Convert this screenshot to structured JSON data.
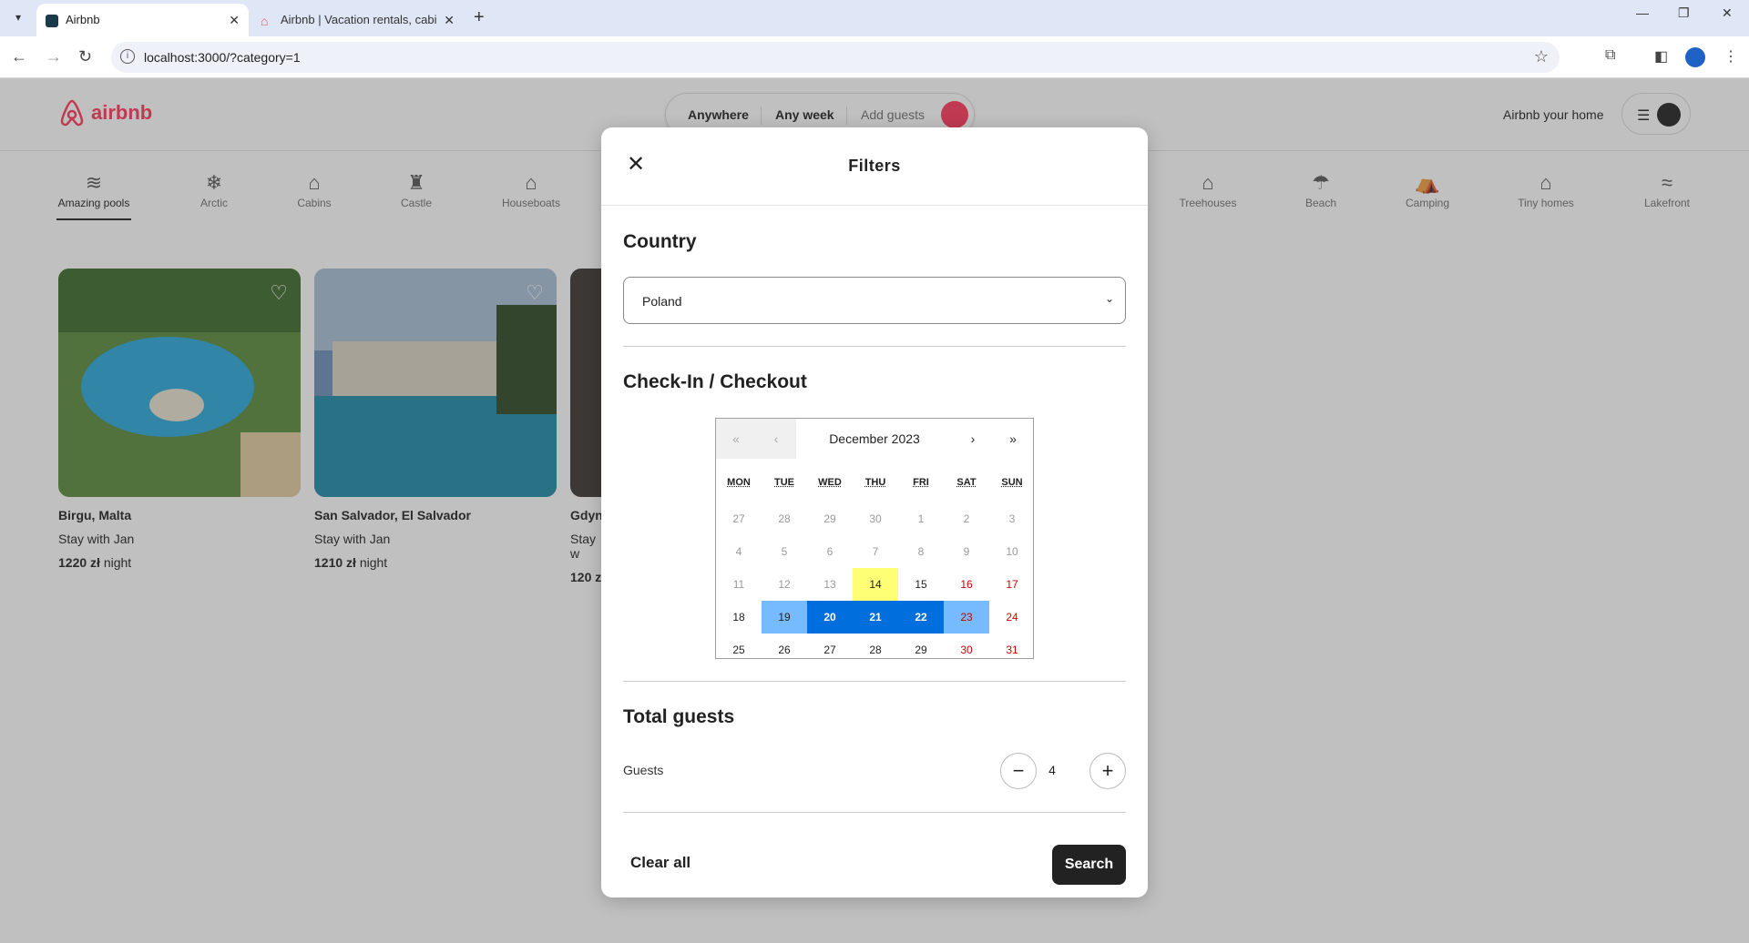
{
  "browser": {
    "tabs": [
      {
        "title": "Airbnb",
        "active": true
      },
      {
        "title": "Airbnb | Vacation rentals, cabins",
        "active": false
      }
    ],
    "url": "localhost:3000/?category=1"
  },
  "header": {
    "logo_text": "airbnb",
    "search": {
      "where": "Anywhere",
      "when": "Any week",
      "who": "Add guests"
    },
    "host_label": "Airbnb your home"
  },
  "categories": [
    {
      "label": "Amazing pools",
      "icon": "pool-icon"
    },
    {
      "label": "Arctic",
      "icon": "snowflake-icon"
    },
    {
      "label": "Cabins",
      "icon": "cabin-icon"
    },
    {
      "label": "Castle",
      "icon": "castle-icon"
    },
    {
      "label": "Houseboats",
      "icon": "houseboat-icon"
    },
    {
      "label": "Treehouses",
      "icon": "treehouse-icon"
    },
    {
      "label": "Beach",
      "icon": "umbrella-icon"
    },
    {
      "label": "Camping",
      "icon": "camping-icon"
    },
    {
      "label": "Tiny homes",
      "icon": "tiny-home-icon"
    },
    {
      "label": "Lakefront",
      "icon": "lakefront-icon"
    }
  ],
  "listings": [
    {
      "location": "Birgu, Malta",
      "host": "Stay with Jan",
      "price": "1220 zł",
      "unit": "night"
    },
    {
      "location": "San Salvador, El Salvador",
      "host": "Stay with Jan",
      "price": "1210 zł",
      "unit": "night"
    },
    {
      "location": "Gdyni",
      "host": "Stay w",
      "price": "120 z",
      "unit": ""
    }
  ],
  "modal": {
    "title": "Filters",
    "country_title": "Country",
    "country_value": "Poland",
    "dates_title": "Check-In / Checkout",
    "calendar": {
      "month_label": "December 2023",
      "nav": [
        "«",
        "‹",
        "›",
        "»"
      ],
      "weekdays": [
        "MON",
        "TUE",
        "WED",
        "THU",
        "FRI",
        "SAT",
        "SUN"
      ],
      "days": [
        [
          "27",
          "28",
          "29",
          "30",
          "1",
          "2",
          "3"
        ],
        [
          "4",
          "5",
          "6",
          "7",
          "8",
          "9",
          "10"
        ],
        [
          "11",
          "12",
          "13",
          "14",
          "15",
          "16",
          "17"
        ],
        [
          "18",
          "19",
          "20",
          "21",
          "22",
          "23",
          "24"
        ],
        [
          "25",
          "26",
          "27",
          "28",
          "29",
          "30",
          "31"
        ]
      ],
      "today": "14",
      "range_start": "19",
      "range_end": "23"
    },
    "guests_title": "Total guests",
    "guests_label": "Guests",
    "guests_count": "4",
    "clear_label": "Clear all",
    "search_label": "Search"
  },
  "colors": {
    "brand": "#ff385c",
    "range": "#006edc",
    "range_edge": "#76baff",
    "today": "#ffff76",
    "weekend": "#d10000"
  }
}
